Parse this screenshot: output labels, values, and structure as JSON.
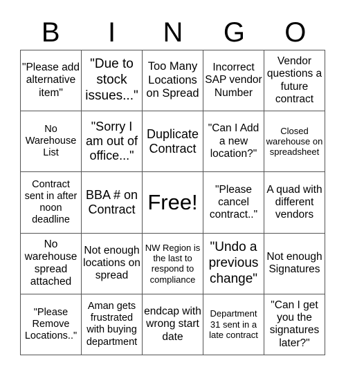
{
  "header": {
    "letters": [
      "B",
      "I",
      "N",
      "G",
      "O"
    ]
  },
  "cells": [
    [
      "\"Please add alternative item\"",
      "\"Due to stock issues...\"",
      "Too Many Locations on Spread",
      "Incorrect SAP vendor Number",
      "Vendor questions a future contract"
    ],
    [
      "No Warehouse List",
      "\"Sorry I am out of office...\"",
      "Duplicate Contract",
      "\"Can I Add a new location?\"",
      "Closed warehouse on spreadsheet"
    ],
    [
      "Contract sent in after noon deadline",
      "BBA # on Contract",
      "Free!",
      "\"Please cancel contract..\"",
      "A quad with different vendors"
    ],
    [
      "No warehouse spread attached",
      "Not enough locations on spread",
      "NW Region is the last to respond to compliance",
      "\"Undo a previous change\"",
      "Not enough Signatures"
    ],
    [
      "\"Please Remove Locations..\"",
      "Aman gets frustrated with buying department",
      "endcap with wrong start date",
      "Department 31 sent in a late contract",
      "\"Can I get you the signatures later?\""
    ]
  ]
}
